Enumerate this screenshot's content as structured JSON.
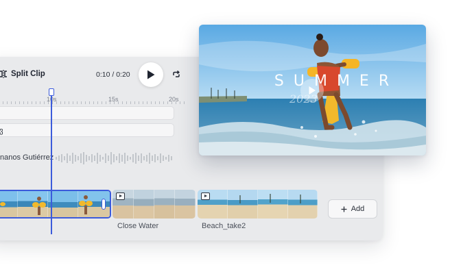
{
  "toolbar": {
    "split_label": "Split Clip",
    "current_time": "0:10",
    "time_separator": " / ",
    "total_time": "0:20"
  },
  "ruler": {
    "ticks": [
      "10s",
      "15s",
      "20s"
    ]
  },
  "tracks": {
    "text_track_label": "ვ",
    "audio_track_label": "nanos Gutiérrez"
  },
  "clips": [
    {
      "label": ""
    },
    {
      "label": "Close Water"
    },
    {
      "label": "Beach_take2"
    }
  ],
  "add_button": {
    "label": "Add",
    "icon": "plus-icon"
  },
  "preview": {
    "title": "SUMMER",
    "year": "2023",
    "play_icon": "play-icon"
  },
  "colors": {
    "accent": "#3b5bdb",
    "panel": "#e9eaec",
    "sky": "#6fb3e6",
    "sea": "#2f7fb3"
  }
}
